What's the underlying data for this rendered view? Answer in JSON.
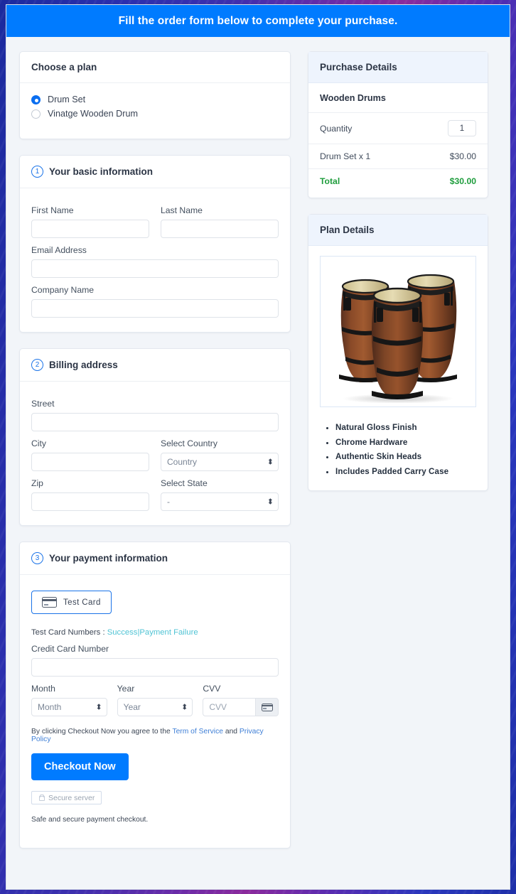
{
  "header": {
    "banner": "Fill the order form below to complete your purchase."
  },
  "plan_card": {
    "title": "Choose a plan",
    "options": [
      {
        "label": "Drum Set",
        "selected": true
      },
      {
        "label": "Vinatge Wooden Drum",
        "selected": false
      }
    ]
  },
  "basic_info": {
    "step": "1",
    "title": "Your basic information",
    "first_name_label": "First Name",
    "first_name_value": "",
    "last_name_label": "Last Name",
    "last_name_value": "",
    "email_label": "Email Address",
    "email_value": "",
    "company_label": "Company Name",
    "company_value": ""
  },
  "billing": {
    "step": "2",
    "title": "Billing address",
    "street_label": "Street",
    "street_value": "",
    "city_label": "City",
    "city_value": "",
    "country_label": "Select Country",
    "country_value": "Country",
    "zip_label": "Zip",
    "zip_value": "",
    "state_label": "Select State",
    "state_value": "-"
  },
  "payment": {
    "step": "3",
    "title": "Your payment information",
    "test_card_button": "Test  Card",
    "test_numbers_prefix": "Test Card Numbers :",
    "test_success_link": "Success",
    "test_separator": "|",
    "test_failure_link": "Payment Failure",
    "cc_label": "Credit Card Number",
    "cc_value": "",
    "month_label": "Month",
    "month_value": "Month",
    "year_label": "Year",
    "year_value": "Year",
    "cvv_label": "CVV",
    "cvv_placeholder": "CVV",
    "agree_prefix": "By clicking Checkout Now you agree to the",
    "terms_link": "Term of Service",
    "agree_and": "and",
    "privacy_link": "Privacy Policy",
    "checkout_button": "Checkout Now",
    "secure_badge": "Secure server",
    "safe_note": "Safe and secure payment checkout."
  },
  "purchase_details": {
    "title": "Purchase Details",
    "product": "Wooden Drums",
    "quantity_label": "Quantity",
    "quantity_value": "1",
    "line_item_label": "Drum Set x 1",
    "line_item_price": "$30.00",
    "total_label": "Total",
    "total_price": "$30.00"
  },
  "plan_details": {
    "title": "Plan Details",
    "image_alt": "conga-drums-photo",
    "features": [
      "Natural Gloss Finish",
      "Chrome Hardware",
      "Authentic Skin Heads",
      "Includes Padded Carry Case"
    ]
  },
  "colors": {
    "accent_blue": "#007bff",
    "step_blue": "#1a73e8",
    "total_green": "#1f9d3d",
    "link_teal": "#4fc3d4",
    "link_blue": "#3f7fd6"
  }
}
